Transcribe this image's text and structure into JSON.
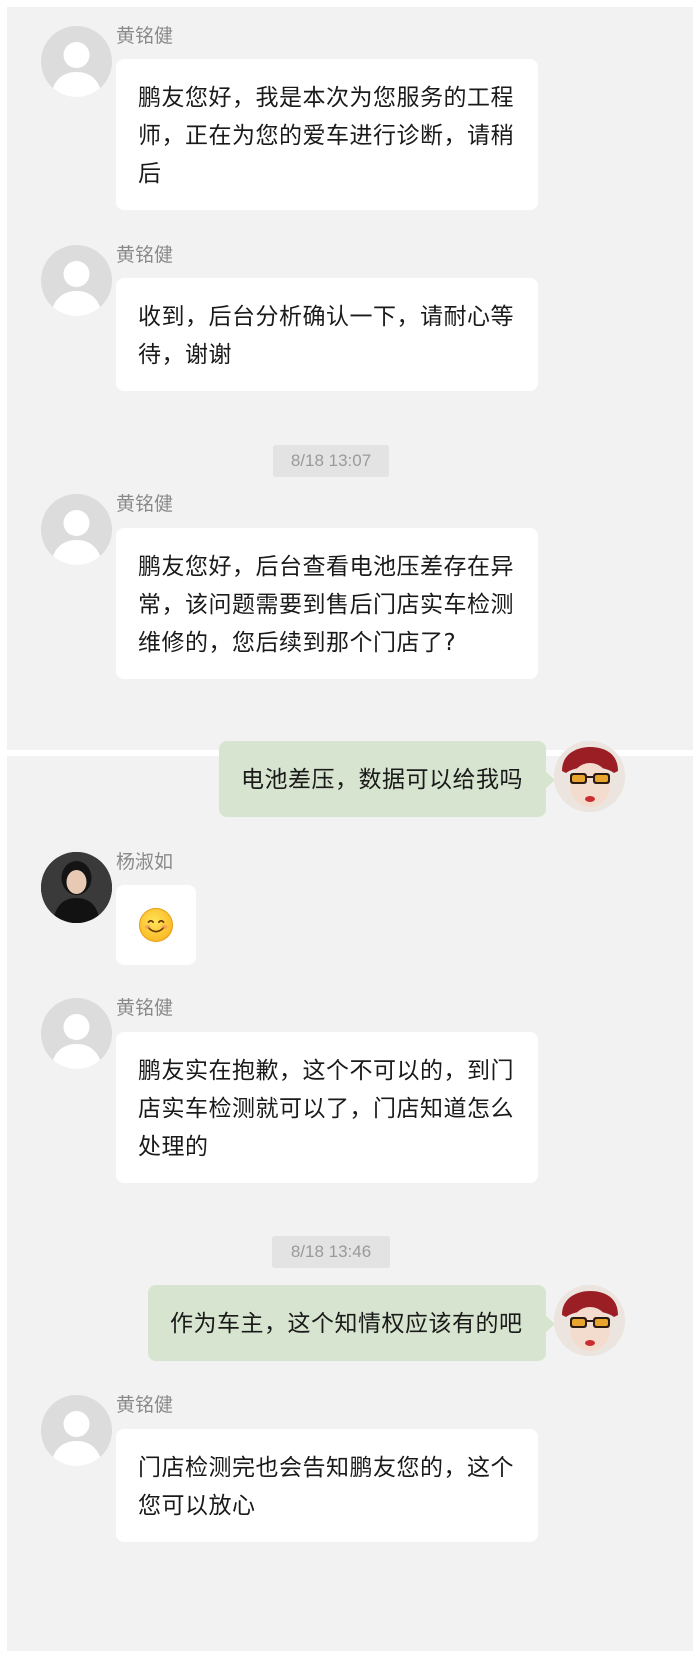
{
  "chat": {
    "messages": [
      {
        "sender": "黄铭健",
        "lines": [
          "鹏友您好，我是本次为您服务的工程",
          "师，正在为您的爱车进行诊断，请稍",
          "后"
        ]
      },
      {
        "sender": "黄铭健",
        "lines": [
          "收到，后台分析确认一下，请耐心等",
          "待，谢谢"
        ]
      },
      {
        "sender": "黄铭健",
        "lines": [
          "鹏友您好，后台查看电池压差存在异",
          "常，该问题需要到售后门店实车检测",
          "维修的，您后续到那个门店了?"
        ]
      },
      {
        "sender": "",
        "lines": [
          "电池差压，数据可以给我吗"
        ]
      },
      {
        "sender": "杨淑如",
        "emoji": "smiling-face"
      },
      {
        "sender": "黄铭健",
        "lines": [
          "鹏友实在抱歉，这个不可以的，到门",
          "店实车检测就可以了，门店知道怎么",
          "处理的"
        ]
      },
      {
        "sender": "",
        "lines": [
          "作为车主，这个知情权应该有的吧"
        ]
      },
      {
        "sender": "黄铭健",
        "lines": [
          "门店检测完也会告知鹏友您的，这个",
          "您可以放心"
        ]
      }
    ],
    "timestamps": [
      "8/18 13:07",
      "8/18 13:46"
    ],
    "colors": {
      "background": "#f2f2f2",
      "bubble_other": "#ffffff",
      "bubble_self": "#d7e4cf",
      "timestamp_bg": "#e3e3e3"
    }
  }
}
